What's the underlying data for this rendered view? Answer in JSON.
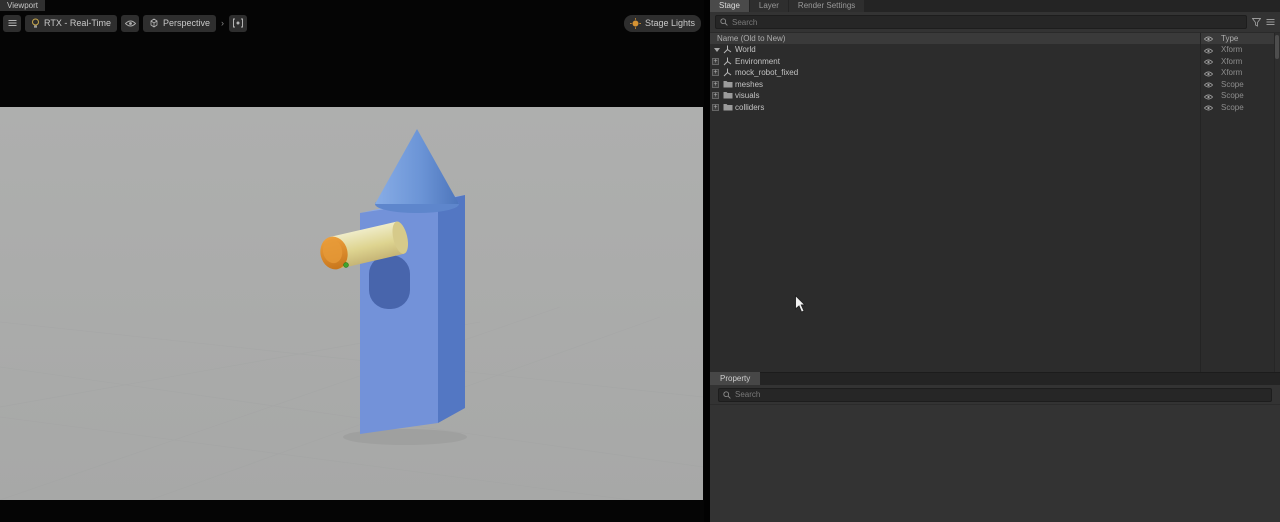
{
  "viewport": {
    "tab_label": "Viewport",
    "toolbar": {
      "renderer_label": "RTX - Real-Time",
      "camera_label": "Perspective",
      "stage_lights_label": "Stage Lights",
      "icons": [
        "hamburger-menu",
        "lightbulb",
        "eye",
        "camera-cube",
        "chevron-right",
        "isolate-select",
        "sun"
      ]
    }
  },
  "stage": {
    "tabs": [
      {
        "label": "Stage",
        "active": true
      },
      {
        "label": "Layer",
        "active": false
      },
      {
        "label": "Render Settings",
        "active": false
      }
    ],
    "search_placeholder": "Search",
    "header": {
      "name": "Name (Old to New)",
      "type": "Type"
    },
    "rows": [
      {
        "label": "World",
        "type": "Xform",
        "icon": "xform",
        "expander": "arrow"
      },
      {
        "label": "Environment",
        "type": "Xform",
        "icon": "xform",
        "expander": "plus"
      },
      {
        "label": "mock_robot_fixed",
        "type": "Xform",
        "icon": "xform",
        "expander": "plus"
      },
      {
        "label": "meshes",
        "type": "Scope",
        "icon": "folder",
        "expander": "plus"
      },
      {
        "label": "visuals",
        "type": "Scope",
        "icon": "folder",
        "expander": "plus"
      },
      {
        "label": "colliders",
        "type": "Scope",
        "icon": "folder",
        "expander": "plus"
      }
    ]
  },
  "property": {
    "tab_label": "Property",
    "search_placeholder": "Search"
  },
  "scene": {
    "colors": {
      "background": "#aaabaa",
      "cone": "#6b94d6",
      "box_front": "#7392d9",
      "box_side": "#5377c3",
      "cylinder": "#ded490",
      "cap_orange": "#e29130",
      "marker_green": "#3fa32c"
    }
  }
}
